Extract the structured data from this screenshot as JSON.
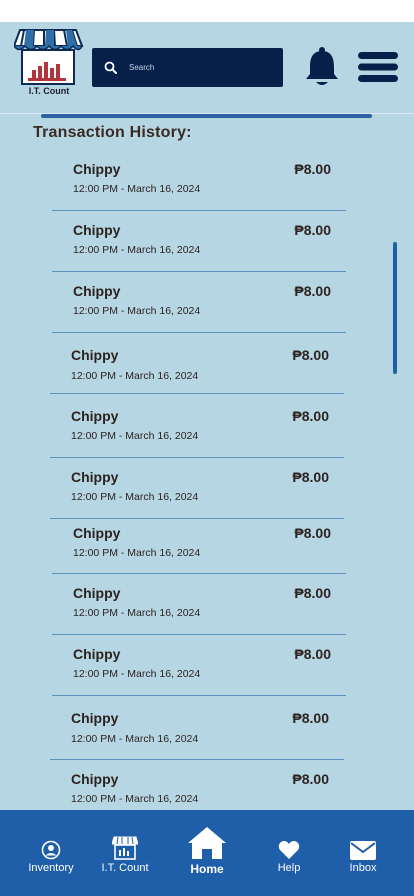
{
  "app": {
    "logo_label": "I.T. Count"
  },
  "search": {
    "placeholder": "Search"
  },
  "history": {
    "title": "Transaction History:",
    "items": [
      {
        "name": "Chippy",
        "amount": "₱8.00",
        "time": "12:00 PM -  March 16, 2024"
      },
      {
        "name": "Chippy",
        "amount": "₱8.00",
        "time": "12:00 PM -  March 16, 2024"
      },
      {
        "name": "Chippy",
        "amount": "₱8.00",
        "time": "12:00 PM -  March 16, 2024"
      },
      {
        "name": "Chippy",
        "amount": "₱8.00",
        "time": "12:00 PM -  March 16, 2024"
      },
      {
        "name": "Chippy",
        "amount": "₱8.00",
        "time": "12:00 PM -  March 16, 2024"
      },
      {
        "name": "Chippy",
        "amount": "₱8.00",
        "time": "12:00 PM -  March 16, 2024"
      },
      {
        "name": "Chippy",
        "amount": "₱8.00",
        "time": "12:00 PM -  March 16, 2024"
      },
      {
        "name": "Chippy",
        "amount": "₱8.00",
        "time": "12:00 PM -  March 16, 2024"
      },
      {
        "name": "Chippy",
        "amount": "₱8.00",
        "time": "12:00 PM -  March 16, 2024"
      },
      {
        "name": "Chippy",
        "amount": "₱8.00",
        "time": "12:00 PM -  March 16, 2024"
      },
      {
        "name": "Chippy",
        "amount": "₱8.00",
        "time": "12:00 PM -  March 16, 2024"
      }
    ]
  },
  "nav": {
    "items": [
      {
        "label": "Inventory",
        "icon": "user-icon"
      },
      {
        "label": "I.T. Count",
        "icon": "store-icon"
      },
      {
        "label": "Home",
        "icon": "home-icon",
        "active": true
      },
      {
        "label": "Help",
        "icon": "heart-icon"
      },
      {
        "label": "Inbox",
        "icon": "envelope-icon"
      }
    ]
  },
  "colors": {
    "background": "#b7d6e3",
    "navy": "#06204a",
    "nav_blue": "#1f5ea8",
    "accent_line": "#2c62a4"
  }
}
